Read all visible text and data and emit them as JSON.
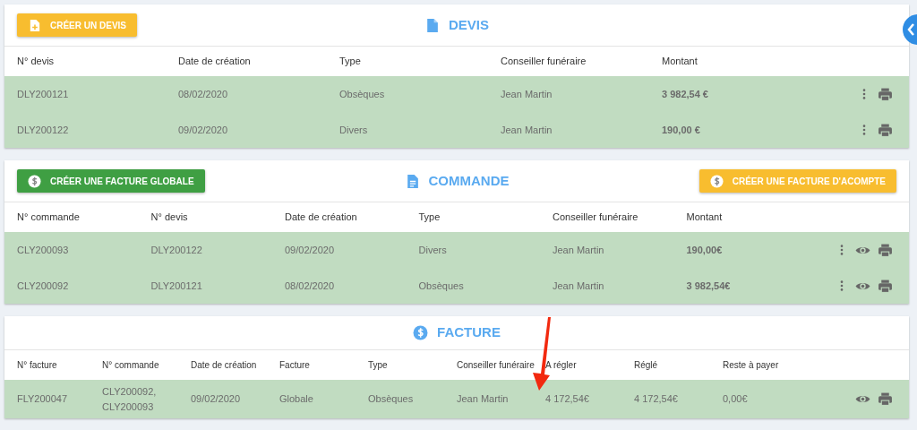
{
  "sections": [
    {
      "kind": "devis",
      "title": "DEVIS",
      "buttons": [
        {
          "kind": "quote",
          "label": "CRÉER UN DEVIS"
        }
      ],
      "columns": [
        {
          "label": "N° devis"
        },
        {
          "label": "Date de création"
        },
        {
          "label": "Type"
        },
        {
          "label": "Conseiller funéraire"
        },
        {
          "label": "Montant"
        }
      ],
      "rows": [
        {
          "cells": [
            "DLY200121",
            "08/02/2020",
            "Obsèques",
            "Jean Martin",
            "3 982,54 €"
          ]
        },
        {
          "cells": [
            "DLY200122",
            "09/02/2020",
            "Divers",
            "Jean Martin",
            "190,00 €"
          ]
        }
      ]
    },
    {
      "kind": "commande",
      "title": "COMMANDE",
      "buttons": [
        {
          "kind": "global-invoice",
          "label": "CRÉER UNE FACTURE GLOBALE"
        },
        {
          "kind": "deposit-invoice",
          "label": "CRÉER UNE FACTURE D'ACOMPTE"
        }
      ],
      "columns": [
        {
          "label": "N° commande"
        },
        {
          "label": "N° devis"
        },
        {
          "label": "Date de création"
        },
        {
          "label": "Type"
        },
        {
          "label": "Conseiller funéraire"
        },
        {
          "label": "Montant"
        }
      ],
      "rows": [
        {
          "cells": [
            "CLY200093",
            "DLY200122",
            "09/02/2020",
            "Divers",
            "Jean Martin",
            "190,00€"
          ]
        },
        {
          "cells": [
            "CLY200092",
            "DLY200121",
            "08/02/2020",
            "Obsèques",
            "Jean Martin",
            "3 982,54€"
          ]
        }
      ]
    },
    {
      "kind": "facture",
      "title": "FACTURE",
      "columns": [
        {
          "label": "N° facture"
        },
        {
          "label": "N° commande"
        },
        {
          "label": "Date de création"
        },
        {
          "label": "Facture"
        },
        {
          "label": "Type"
        },
        {
          "label": "Conseiller funéraire"
        },
        {
          "label": "A régler"
        },
        {
          "label": "Réglé"
        },
        {
          "label": "Reste à payer"
        }
      ],
      "rows": [
        {
          "cells": [
            "FLY200047",
            "CLY200092, CLY200093",
            "09/02/2020",
            "Globale",
            "Obsèques",
            "Jean Martin",
            "4 172,54€",
            "4 172,54€",
            "0,00€"
          ]
        }
      ]
    }
  ]
}
